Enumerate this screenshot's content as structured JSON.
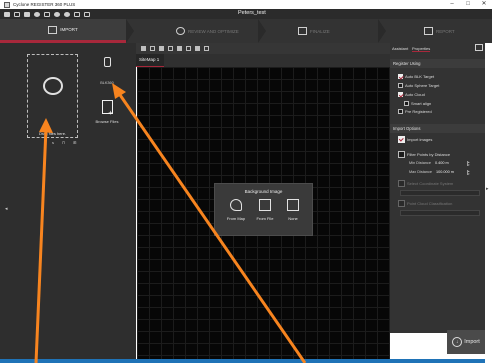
{
  "window": {
    "title": "Cyclone REGISTER 360 PLUS",
    "project": "Peters_test",
    "controls": [
      "–",
      "□",
      "✕"
    ]
  },
  "steps": {
    "import": "IMPORT",
    "review": "REVIEW AND OPTIMIZE",
    "finalize": "FINALIZE",
    "report": "REPORT"
  },
  "left_panel": {
    "drop_label": "Drag files here.",
    "device_label": "BLK360",
    "browse_label": "Browse Files",
    "small_icons": [
      "s",
      "⊓",
      "⊞"
    ],
    "toggle_glyph": "◂"
  },
  "view": {
    "tab": "SiteMap 1"
  },
  "bg_popup": {
    "title": "Background Image",
    "options": [
      {
        "label": "From Map",
        "icon": "map-pin-icon"
      },
      {
        "label": "From File",
        "icon": "file-add-icon"
      },
      {
        "label": "None",
        "icon": "folder-icon"
      }
    ]
  },
  "right_panel": {
    "tabs": [
      "Assistant",
      "Properties"
    ],
    "register_using": {
      "title": "Register Using",
      "auto_blk": "Auto BLK Target",
      "auto_sphere": "Auto Sphere Target",
      "auto_cloud": "Auto Cloud",
      "smart_align": "Smart align",
      "pre_registered": "Pre Registered"
    },
    "import_options": {
      "title": "Import Options",
      "import_images": "Import images",
      "filter_points": "Filter Points by Distance",
      "min_label": "Min Distance",
      "min_value": "0.400 m",
      "max_label": "Max Distance",
      "max_value": "100.000 m",
      "coord_system": "Select Coordinate System",
      "point_cloud_class": "Point Cloud Classification"
    },
    "checked": {
      "auto_blk": true,
      "auto_sphere": false,
      "auto_cloud": true,
      "smart_align": false,
      "pre_registered": false,
      "import_images": true,
      "filter_points": false,
      "coord_system": false,
      "point_cloud_class": false
    }
  },
  "import_button": "Import",
  "right_arrow_glyph": "▸",
  "colors": {
    "accent": "#a7283b",
    "annotation_arrow": "#f7841f",
    "status_bar": "#1f73b7"
  }
}
